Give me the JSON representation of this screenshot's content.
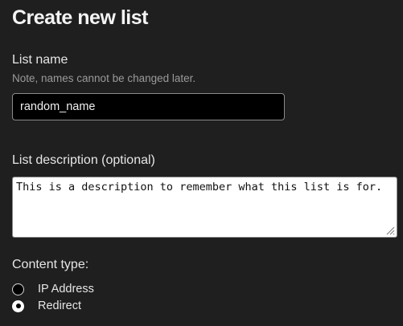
{
  "page": {
    "title": "Create new list"
  },
  "list_name": {
    "label": "List name",
    "hint": "Note, names cannot be changed later.",
    "value": "random_name"
  },
  "list_description": {
    "label": "List description (optional)",
    "value": "This is a description to remember what this list is for."
  },
  "content_type": {
    "label": "Content type:",
    "options": [
      {
        "label": "IP Address",
        "selected": false
      },
      {
        "label": "Redirect",
        "selected": true
      }
    ]
  }
}
